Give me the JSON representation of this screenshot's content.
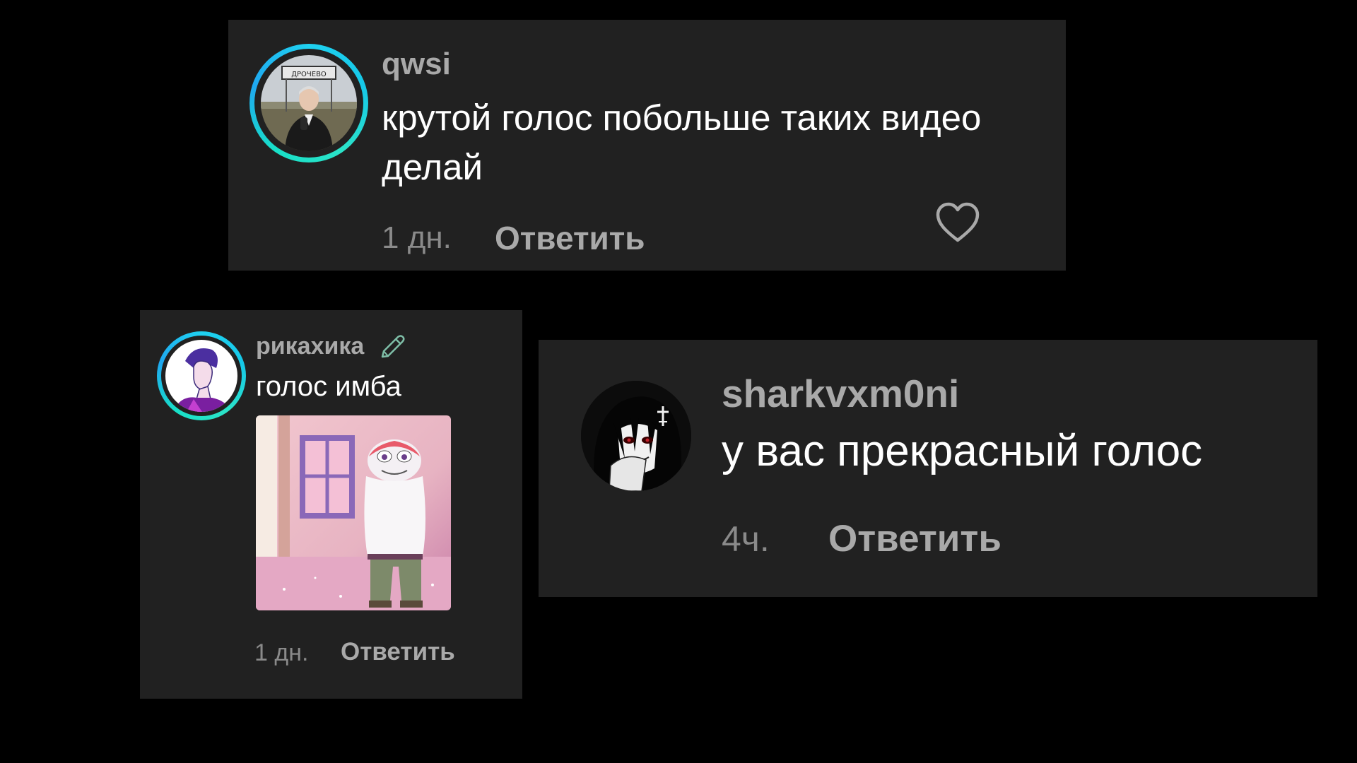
{
  "comments": [
    {
      "username": "qwsi",
      "text": "крутой голос побольше таких видео делай",
      "time": "1 дн.",
      "reply_label": "Ответить",
      "avatar_sign_text": "ДРОЧЕВО",
      "has_like_button": true
    },
    {
      "username": "рикахика",
      "text": "голос имба",
      "time": "1 дн.",
      "reply_label": "Ответить",
      "has_attached_image": true
    },
    {
      "username": "sharkvxm0ni",
      "text": "у вас прекрасный голос",
      "time": "4ч.",
      "reply_label": "Ответить"
    }
  ],
  "icons": {
    "like": "heart-outline-icon",
    "username_badge": "pencil-icon"
  },
  "colors": {
    "background": "#000000",
    "card": "#212121",
    "ring_accent": "#1fd1f0",
    "username": "#a9a9a9",
    "text": "#ffffff",
    "meta": "#8a8a8a"
  }
}
